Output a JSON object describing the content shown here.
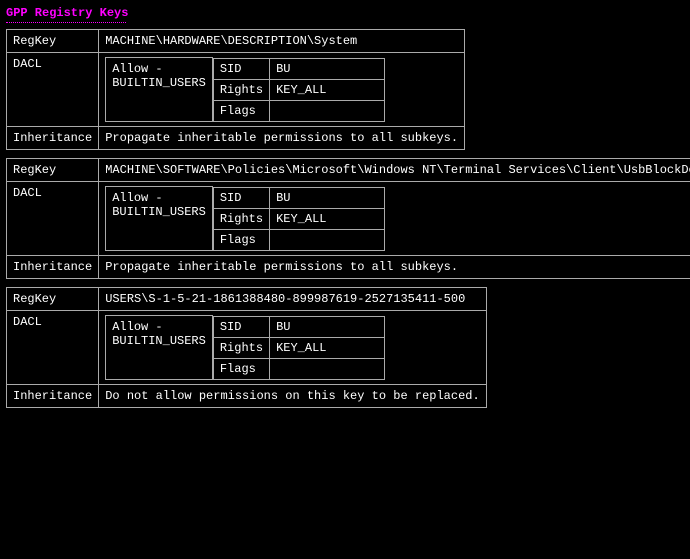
{
  "title": "GPP Registry Keys",
  "labels": {
    "regkey": "RegKey",
    "dacl": "DACL",
    "inheritance": "Inheritance",
    "allow_prefix": "Allow -",
    "sid": "SID",
    "rights": "Rights",
    "flags": "Flags"
  },
  "entries": [
    {
      "regkey": "MACHINE\\HARDWARE\\DESCRIPTION\\System",
      "dacl": {
        "principal": "BUILTIN_USERS",
        "sid": "BU",
        "rights": "KEY_ALL",
        "flags": ""
      },
      "inheritance": "Propagate inheritable permissions to all subkeys."
    },
    {
      "regkey": "MACHINE\\SOFTWARE\\Policies\\Microsoft\\Windows NT\\Terminal Services\\Client\\UsbBlockDeviceBySetupClasses",
      "dacl": {
        "principal": "BUILTIN_USERS",
        "sid": "BU",
        "rights": "KEY_ALL",
        "flags": ""
      },
      "inheritance": "Propagate inheritable permissions to all subkeys."
    },
    {
      "regkey": "USERS\\S-1-5-21-1861388480-899987619-2527135411-500",
      "dacl": {
        "principal": "BUILTIN_USERS",
        "sid": "BU",
        "rights": "KEY_ALL",
        "flags": ""
      },
      "inheritance": "Do not allow permissions on this key to be replaced."
    }
  ]
}
